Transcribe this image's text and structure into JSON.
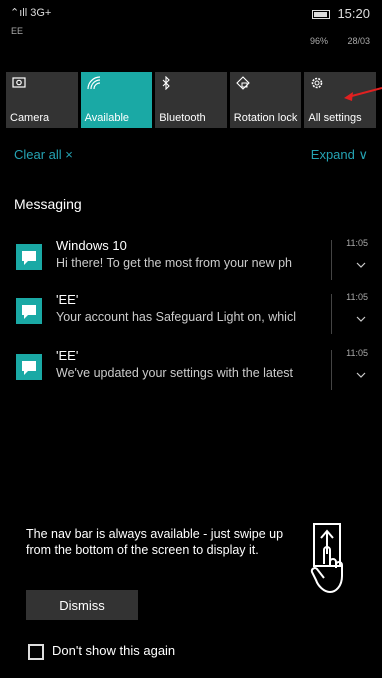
{
  "status": {
    "signal": "3G+",
    "carrier": "EE",
    "time": "15:20",
    "battery_pct": "96%",
    "date": "28/03"
  },
  "quick_actions": [
    {
      "label": "Camera",
      "icon": "camera-icon",
      "active": false
    },
    {
      "label": "Available",
      "icon": "wifi-icon",
      "active": true
    },
    {
      "label": "Bluetooth",
      "icon": "bluetooth-icon",
      "active": false
    },
    {
      "label": "Rotation lock",
      "icon": "rotation-lock-icon",
      "active": false
    },
    {
      "label": "All settings",
      "icon": "gear-icon",
      "active": false
    }
  ],
  "actions": {
    "clear_all": "Clear all ×",
    "expand": "Expand ∨"
  },
  "section": "Messaging",
  "notifications": [
    {
      "title": "Windows 10",
      "body": "Hi there! To get the most from your new ph",
      "time": "11:05"
    },
    {
      "title": "'EE'",
      "body": "Your account has Safeguard Light on, whicl",
      "time": "11:05"
    },
    {
      "title": "'EE'",
      "body": "We've updated your settings with the latest",
      "time": "11:05"
    }
  ],
  "tip": {
    "text": "The nav bar is always available - just swipe up from the bottom of the screen to display it.",
    "dismiss_label": "Dismiss",
    "dont_show_label": "Don't show this again"
  },
  "colors": {
    "accent": "#1aa9a5",
    "link": "#25a3b3",
    "arrow": "#e02020"
  }
}
